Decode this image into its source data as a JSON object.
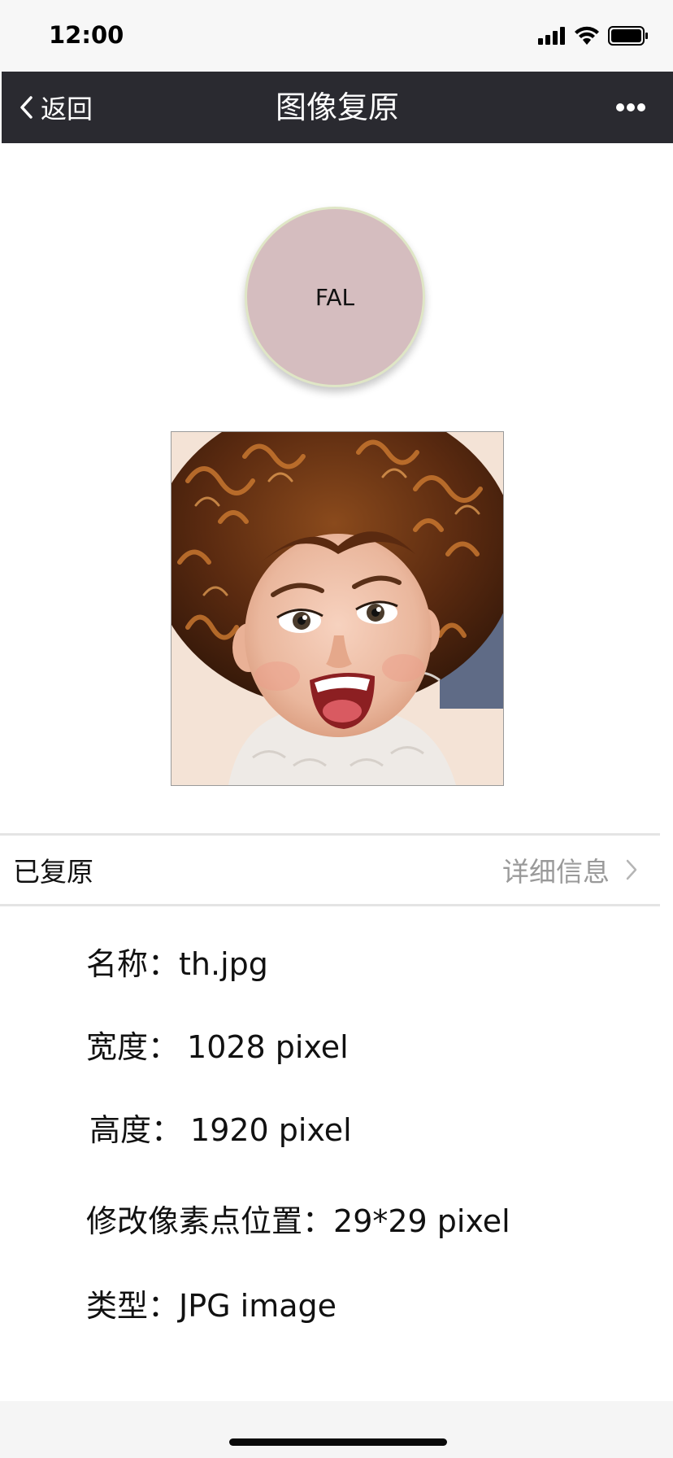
{
  "status_bar": {
    "time": "12:00",
    "icons": [
      "signal-icon",
      "wifi-icon",
      "battery-icon"
    ]
  },
  "nav": {
    "back_label": "返回",
    "title": "图像复原",
    "more_icon": "more-icon"
  },
  "badge": {
    "text": "FAL"
  },
  "photo": {
    "description_icon": "photo-image"
  },
  "status_row": {
    "label": "已复原",
    "details_label": "详细信息"
  },
  "info": {
    "name_key": "名称：",
    "name_value": "th.jpg",
    "width_key": "宽度：",
    "width_value": "1028 pixel",
    "height_key": "高度：",
    "height_value": "1920 pixel",
    "position_key": "修改像素点位置：",
    "position_value": "29*29 pixel",
    "type_key": "类型：",
    "type_value": "JPG image"
  },
  "colors": {
    "nav_background": "#2a2a30",
    "badge_fill": "#d5bdbf",
    "badge_border": "#dfe6c6",
    "secondary_text": "#9a9a9a"
  }
}
